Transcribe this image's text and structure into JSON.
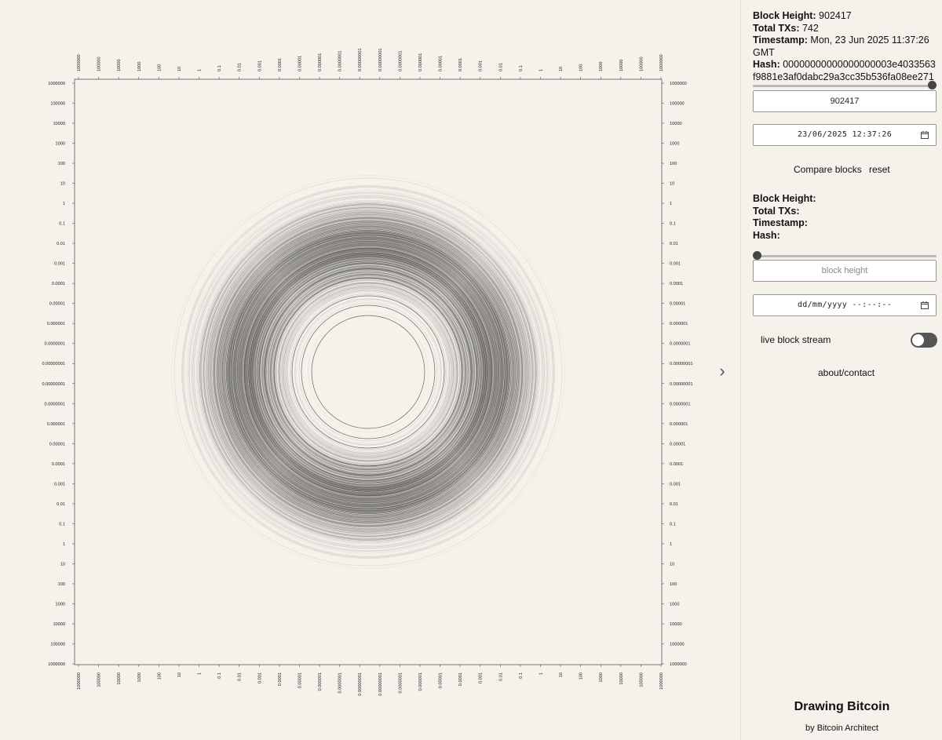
{
  "current_block": {
    "height_label": "Block Height:",
    "height_value": "902417",
    "txs_label": "Total TXs:",
    "txs_value": "742",
    "timestamp_label": "Timestamp:",
    "timestamp_value": "Mon, 23 Jun 2025 11:37:26 GMT",
    "hash_label": "Hash:",
    "hash_value": "00000000000000000003e4033563f9881e3af0dabc29a3cc35b536fa08ee271",
    "slider_level": 1.0,
    "height_input_value": "902417",
    "datetime_value": "23/06/2025 12:37:26"
  },
  "compare": {
    "compare_label": "Compare blocks",
    "reset_label": "reset",
    "height_label": "Block Height:",
    "txs_label": "Total TXs:",
    "timestamp_label": "Timestamp:",
    "hash_label": "Hash:",
    "slider_level": 0.0,
    "height_placeholder": "block height",
    "datetime_placeholder": "dd/mm/yyyy --:--:--"
  },
  "live_stream": {
    "label": "live block stream",
    "enabled": false
  },
  "about_label": "about/contact",
  "brand": {
    "title": "Drawing Bitcoin",
    "subtitle": "by Bitcoin Architect"
  },
  "icons": {
    "collapse": "chevron-right-icon",
    "calendar": "calendar-icon"
  },
  "colors": {
    "background": "#f5f2ec",
    "ring": "#3a3835",
    "frame": "#555555"
  },
  "chart_data": {
    "type": "concentric-rings",
    "scale": "log",
    "axis_tick_labels": [
      "1000000",
      "100000",
      "10000",
      "1000",
      "100",
      "10",
      "1",
      "0.1",
      "0.01",
      "0.001",
      "0.0001",
      "0.00001",
      "0.000001",
      "0.0000001",
      "0.00000001",
      "0.00000001",
      "0.0000001",
      "0.000001",
      "0.00001",
      "0.0001",
      "0.001",
      "0.01",
      "0.1",
      "1",
      "10",
      "100",
      "1000",
      "10000",
      "100000",
      "1000000"
    ],
    "ring_value_range": [
      0.01,
      1
    ]
  }
}
